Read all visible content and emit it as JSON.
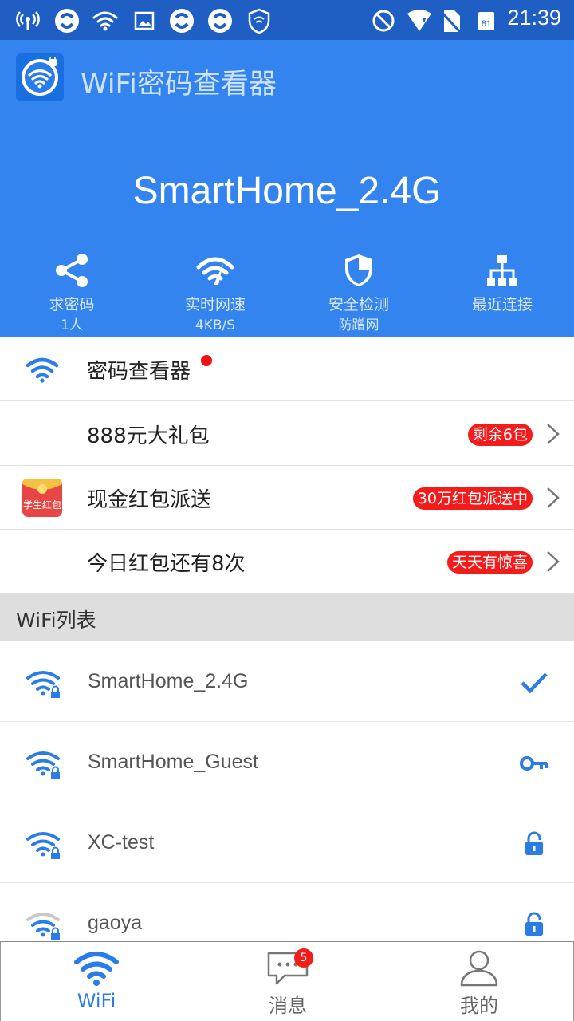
{
  "status_bar": {
    "time": "21:39",
    "calendar_day": "81"
  },
  "app": {
    "title": "WiFi密码查看器"
  },
  "current_network": {
    "ssid": "SmartHome_2.4G"
  },
  "features": [
    {
      "label": "求密码",
      "sub": "1人",
      "icon": "share-icon"
    },
    {
      "label": "实时网速",
      "sub": "4KB/S",
      "icon": "speedometer-icon"
    },
    {
      "label": "安全检测",
      "sub": "防蹭网",
      "icon": "shield-icon"
    },
    {
      "label": "最近连接",
      "sub": "",
      "icon": "network-tree-icon"
    }
  ],
  "menu": [
    {
      "label": "密码查看器",
      "badge": "",
      "icon": "wifi-icon"
    },
    {
      "label": "888元大礼包",
      "badge": "剩余6包",
      "icon": ""
    },
    {
      "label": "现金红包派送",
      "badge": "30万红包派送中",
      "icon": "red-envelope-icon",
      "icon_text": "学生红包"
    },
    {
      "label": "今日红包还有8次",
      "badge": "天天有惊喜",
      "icon": ""
    }
  ],
  "wifi_section_title": "WiFi列表",
  "wifi_list": [
    {
      "name": "SmartHome_2.4G",
      "state": "connected",
      "state_icon": "checkmark-icon",
      "signal": "strong"
    },
    {
      "name": "SmartHome_Guest",
      "state": "saved",
      "state_icon": "key-icon",
      "signal": "strong"
    },
    {
      "name": "XC-test",
      "state": "locked",
      "state_icon": "lock-icon",
      "signal": "strong"
    },
    {
      "name": "gaoya",
      "state": "locked",
      "state_icon": "lock-icon",
      "signal": "weak"
    }
  ],
  "bottom_nav": [
    {
      "label": "WiFi",
      "active": true,
      "icon": "wifi-icon"
    },
    {
      "label": "消息",
      "active": false,
      "icon": "message-icon",
      "badge": "5"
    },
    {
      "label": "我的",
      "active": false,
      "icon": "user-icon"
    }
  ],
  "colors": {
    "header": "#3384ee",
    "status_bar": "#1f5fc4",
    "accent": "#2a7de8",
    "badge": "#f41b1b"
  }
}
